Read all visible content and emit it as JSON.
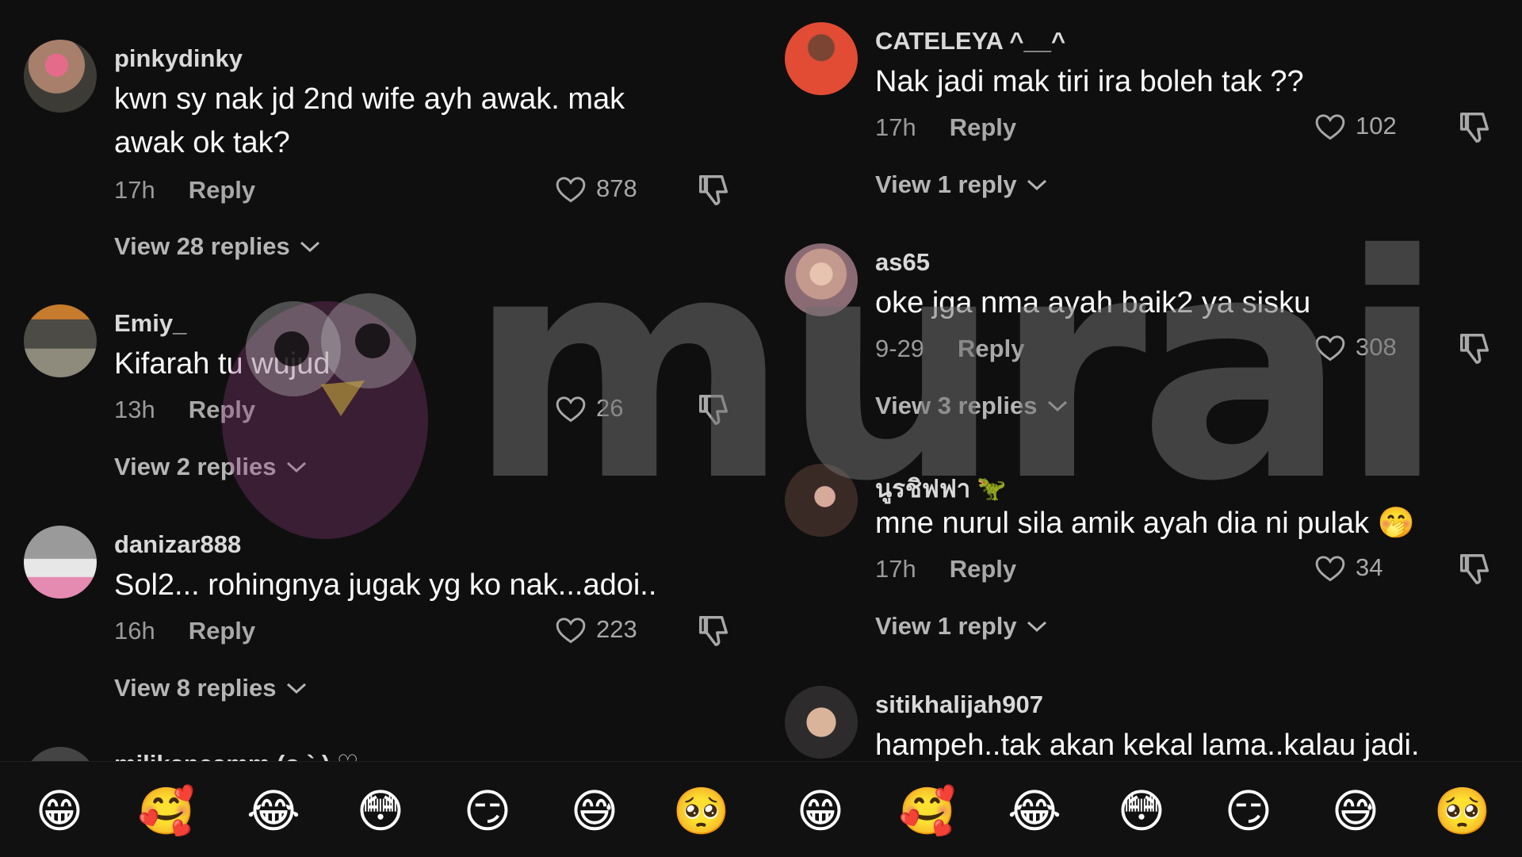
{
  "watermark": "murai",
  "comments_left": [
    {
      "username": "pinkydinky",
      "text": "kwn sy nak jd 2nd wife ayh awak. mak awak ok tak?",
      "time": "17h",
      "reply": "Reply",
      "likes": "878",
      "view_replies": "View 28 replies"
    },
    {
      "username": "Emiy_",
      "text": "Kifarah tu wujud",
      "time": "13h",
      "reply": "Reply",
      "likes": "26",
      "view_replies": "View 2 replies"
    },
    {
      "username": "danizar888",
      "text": "Sol2... rohingnya jugak yg ko nak...adoi..",
      "time": "16h",
      "reply": "Reply",
      "likes": "223",
      "view_replies": "View 8 replies"
    },
    {
      "username": "milikaneamm (o ` ) ♡"
    }
  ],
  "comments_right": [
    {
      "username": "CATELEYA ^__^",
      "text": "Nak jadi mak tiri ira boleh tak ??",
      "time": "17h",
      "reply": "Reply",
      "likes": "102",
      "view_replies": "View 1 reply"
    },
    {
      "username": "as65",
      "text": "oke jga nma ayah baik2 ya sisku",
      "time": "9-29",
      "reply": "Reply",
      "likes": "308",
      "view_replies": "View 3 replies"
    },
    {
      "username": "นูรชิฟฟา",
      "username_emoji": "🦖",
      "text": "mne nurul sila amik ayah dia ni pulak 🤭",
      "time": "17h",
      "reply": "Reply",
      "likes": "34",
      "view_replies": "View 1 reply"
    },
    {
      "username": "sitikhalijah907",
      "text": "hampeh..tak akan kekal lama..kalau jadi."
    }
  ],
  "emoji_bar": [
    "😁",
    "🥰",
    "😂",
    "😳",
    "😏",
    "😅",
    "🥺",
    "😁",
    "🥰",
    "😂",
    "😳",
    "😏",
    "😅",
    "🥺"
  ],
  "colors": {
    "background": "#0f0f0f",
    "text": "#fafafa",
    "muted": "#9a9a9a"
  }
}
